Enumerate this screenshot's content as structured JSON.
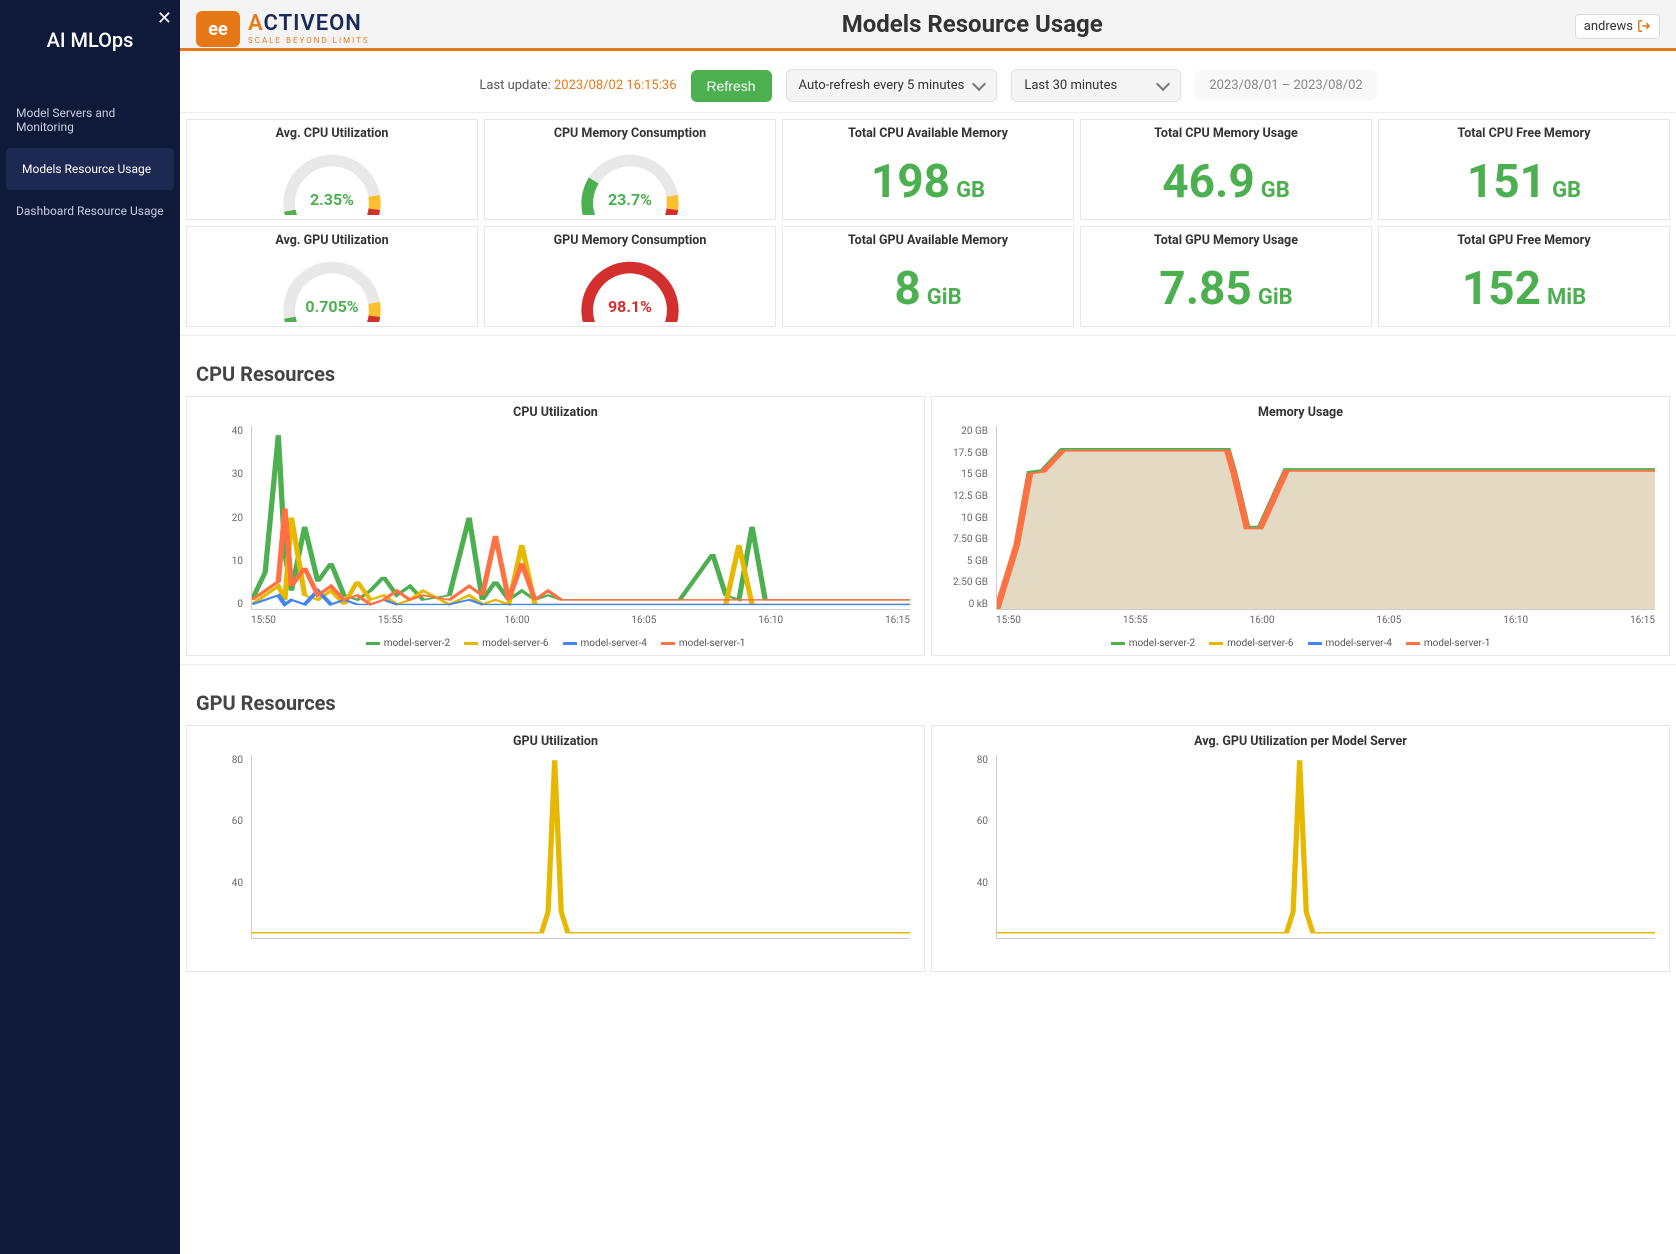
{
  "sidebar": {
    "title": "AI MLOps",
    "items": [
      {
        "label": "Model Servers and Monitoring",
        "active": false
      },
      {
        "label": "Models Resource Usage",
        "active": true
      },
      {
        "label": "Dashboard Resource Usage",
        "active": false
      }
    ]
  },
  "header": {
    "page_title": "Models Resource Usage",
    "user": "andrews"
  },
  "controls": {
    "last_update_label": "Last update: ",
    "last_update_ts": "2023/08/02 16:15:36",
    "refresh_label": "Refresh",
    "auto_refresh": "Auto-refresh every 5 minutes",
    "time_range": "Last 30 minutes",
    "date_range": "2023/08/01 – 2023/08/02"
  },
  "gauges": [
    {
      "title": "Avg. CPU Utilization",
      "value_text": "2.35%",
      "pct": 2.35,
      "color": "green"
    },
    {
      "title": "CPU Memory Consumption",
      "value_text": "23.7%",
      "pct": 23.7,
      "color": "green"
    },
    {
      "title": "Avg. GPU Utilization",
      "value_text": "0.705%",
      "pct": 0.705,
      "color": "green"
    },
    {
      "title": "GPU Memory Consumption",
      "value_text": "98.1%",
      "pct": 98.1,
      "color": "red"
    }
  ],
  "stats_row1": [
    {
      "title": "Total CPU Available Memory",
      "value": "198",
      "unit": "GB"
    },
    {
      "title": "Total CPU Memory Usage",
      "value": "46.9",
      "unit": "GB"
    },
    {
      "title": "Total CPU Free Memory",
      "value": "151",
      "unit": "GB"
    }
  ],
  "stats_row2": [
    {
      "title": "Total GPU Available Memory",
      "value": "8",
      "unit": "GiB"
    },
    {
      "title": "Total GPU Memory Usage",
      "value": "7.85",
      "unit": "GiB"
    },
    {
      "title": "Total GPU Free Memory",
      "value": "152",
      "unit": "MiB"
    }
  ],
  "sections": {
    "cpu": "CPU Resources",
    "gpu": "GPU Resources"
  },
  "series_colors": {
    "model-server-2": "#4caf50",
    "model-server-6": "#e6b800",
    "model-server-4": "#4285f4",
    "model-server-1": "#ff7043"
  },
  "chart_data": [
    {
      "id": "cpu_util",
      "title": "CPU Utilization",
      "type": "line",
      "y_ticks": [
        "40",
        "30",
        "20",
        "10",
        "0"
      ],
      "x_ticks": [
        "15:50",
        "15:55",
        "16:00",
        "16:05",
        "16:10",
        "16:15"
      ],
      "legend": [
        "model-server-2",
        "model-server-6",
        "model-server-4",
        "model-server-1"
      ],
      "ylim": [
        0,
        40
      ],
      "x": [
        0,
        2,
        4,
        5,
        6,
        8,
        10,
        12,
        14,
        16,
        18,
        20,
        22,
        24,
        26,
        30,
        33,
        35,
        37,
        39,
        41,
        43,
        45,
        47,
        50,
        55,
        60,
        65,
        70,
        72,
        74,
        76,
        78,
        82,
        85,
        88,
        92,
        96,
        100
      ],
      "series": {
        "model-server-2": [
          2,
          8,
          38,
          12,
          4,
          18,
          6,
          10,
          3,
          2,
          4,
          7,
          3,
          5,
          2,
          3,
          20,
          2,
          6,
          2,
          4,
          2,
          3,
          2,
          2,
          2,
          2,
          2,
          12,
          3,
          2,
          18,
          2,
          2,
          2,
          2,
          2,
          2,
          2
        ],
        "model-server-6": [
          1,
          3,
          5,
          2,
          20,
          3,
          2,
          4,
          1,
          6,
          2,
          3,
          1,
          2,
          4,
          1,
          3,
          1,
          2,
          1,
          14,
          1,
          1,
          1,
          1,
          1,
          1,
          1,
          1,
          1,
          14,
          1,
          1,
          1,
          1,
          1,
          1,
          1,
          1
        ],
        "model-server-4": [
          1,
          2,
          3,
          1,
          2,
          1,
          4,
          1,
          2,
          1,
          1,
          2,
          1,
          1,
          1,
          1,
          2,
          1,
          1,
          1,
          1,
          1,
          1,
          1,
          1,
          1,
          1,
          1,
          1,
          1,
          1,
          1,
          1,
          1,
          1,
          1,
          1,
          1,
          1
        ],
        "model-server-1": [
          2,
          4,
          6,
          22,
          5,
          9,
          3,
          5,
          2,
          3,
          1,
          2,
          4,
          2,
          3,
          2,
          5,
          3,
          16,
          2,
          10,
          2,
          4,
          2,
          2,
          2,
          2,
          2,
          2,
          2,
          2,
          2,
          2,
          2,
          2,
          2,
          2,
          2,
          2
        ]
      }
    },
    {
      "id": "mem_usage",
      "title": "Memory Usage",
      "type": "area",
      "y_ticks": [
        "20 GB",
        "17.5 GB",
        "15 GB",
        "12.5 GB",
        "10 GB",
        "7.50 GB",
        "5 GB",
        "2.50 GB",
        "0 kB"
      ],
      "x_ticks": [
        "15:50",
        "15:55",
        "16:00",
        "16:05",
        "16:10",
        "16:15"
      ],
      "legend": [
        "model-server-2",
        "model-server-6",
        "model-server-4",
        "model-server-1"
      ],
      "ylim": [
        0,
        20
      ],
      "x": [
        0,
        3,
        5,
        7,
        10,
        35,
        36,
        38,
        40,
        44,
        46,
        100
      ],
      "series": {
        "model-server-2": [
          0,
          7,
          15,
          15.2,
          17.5,
          17.5,
          15,
          9,
          9,
          15.3,
          15.3,
          15.3
        ],
        "model-server-1": [
          0,
          7,
          14.8,
          15,
          17.3,
          17.3,
          14.8,
          8.8,
          8.8,
          15.1,
          15.1,
          15.1
        ]
      }
    },
    {
      "id": "gpu_util",
      "title": "GPU Utilization",
      "type": "line",
      "y_ticks": [
        "80",
        "60",
        "40",
        ""
      ],
      "x_ticks": [],
      "legend": [],
      "ylim": [
        20,
        90
      ],
      "x": [
        0,
        44,
        45,
        46,
        47,
        48,
        100
      ],
      "series": {
        "main": [
          22,
          22,
          30,
          88,
          30,
          22,
          22
        ]
      },
      "single_color": "#e6b800"
    },
    {
      "id": "gpu_util_per",
      "title": "Avg. GPU Utilization per Model Server",
      "type": "line",
      "y_ticks": [
        "80",
        "60",
        "40",
        ""
      ],
      "x_ticks": [],
      "legend": [],
      "ylim": [
        20,
        90
      ],
      "x": [
        0,
        44,
        45,
        46,
        47,
        48,
        100
      ],
      "series": {
        "main": [
          22,
          22,
          30,
          88,
          30,
          22,
          22
        ]
      },
      "single_color": "#e6b800"
    }
  ]
}
